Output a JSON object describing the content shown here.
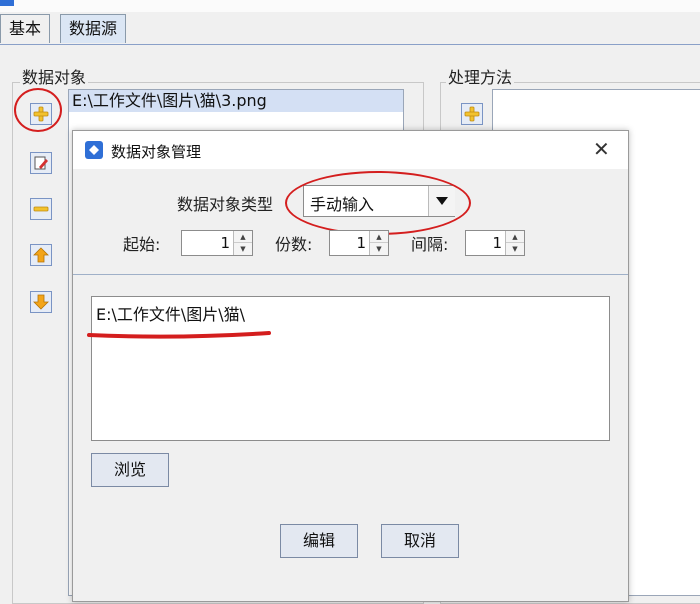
{
  "tabs": [
    {
      "label": "基本",
      "active": false
    },
    {
      "label": "数据源",
      "active": true
    }
  ],
  "left_panel": {
    "group_label": "数据对象",
    "list_items": [
      "E:\\工作文件\\图片\\猫\\3.png"
    ]
  },
  "right_panel": {
    "group_label": "处理方法"
  },
  "dialog": {
    "title": "数据对象管理",
    "close_glyph": "✕",
    "type_label": "数据对象类型",
    "type_value": "手动输入",
    "start_label": "起始:",
    "start_value": "1",
    "copies_label": "份数:",
    "copies_value": "1",
    "interval_label": "间隔:",
    "interval_value": "1",
    "content_text": "E:\\工作文件\\图片\\猫\\",
    "browse_label": "浏览",
    "edit_label": "编辑",
    "cancel_label": "取消"
  },
  "colors": {
    "annotation_red": "#d41e1e",
    "accent_blue": "#2f6fd6",
    "icon_orange": "#f3a51a",
    "icon_yellow": "#f2c22e"
  },
  "icons": {
    "add": "plus-icon",
    "edit": "edit-icon",
    "remove": "minus-icon",
    "up": "arrow-up-icon",
    "down": "arrow-down-icon",
    "combo": "triangle-down-icon"
  }
}
